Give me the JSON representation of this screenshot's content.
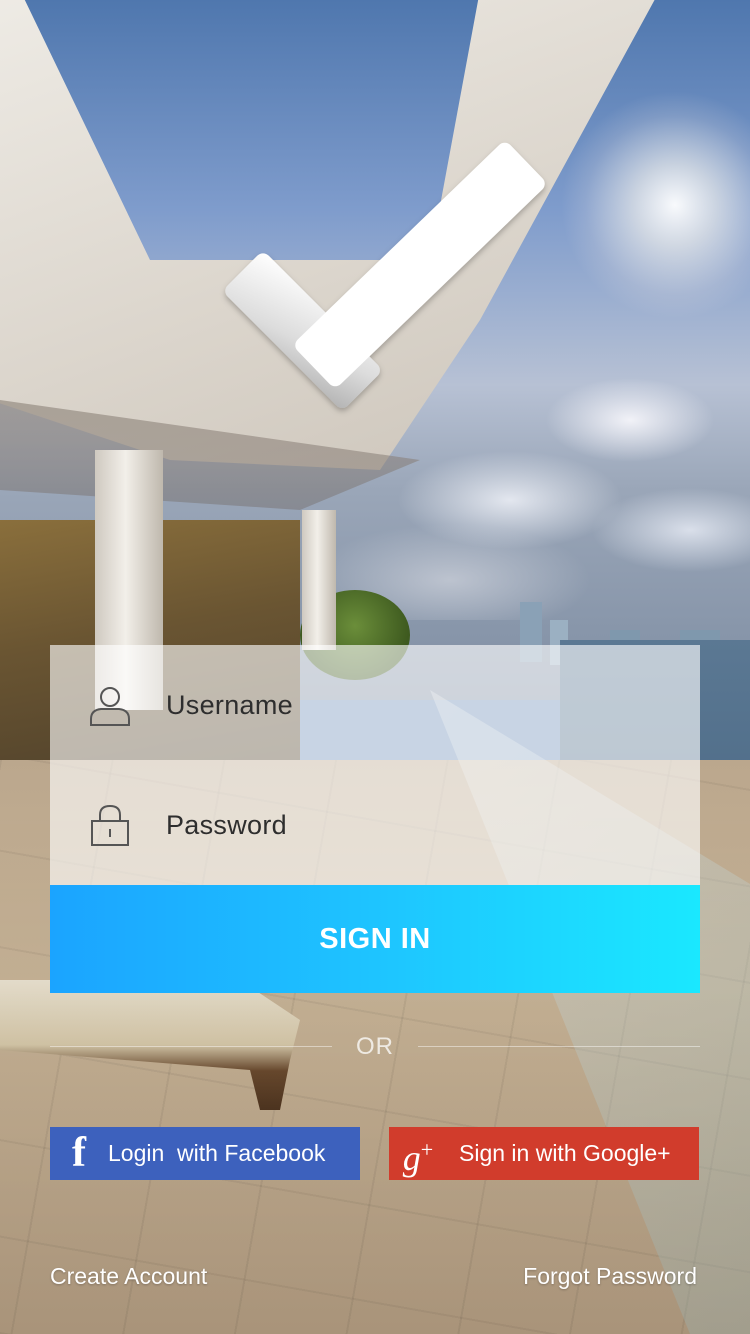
{
  "login_form": {
    "username_placeholder": "Username",
    "password_placeholder": "Password",
    "signin_label": "SIGN IN"
  },
  "divider": {
    "text": "OR"
  },
  "social": {
    "facebook_label": "Login  with Facebook",
    "google_label": "Sign in with Google+"
  },
  "links": {
    "create_account": "Create Account",
    "forgot_password": "Forgot Password"
  },
  "icons": {
    "logo": "checkmark-logo",
    "username": "user-icon",
    "password": "lock-icon",
    "facebook": "facebook-icon",
    "google": "google-plus-icon"
  },
  "colors": {
    "signin_gradient_start": "#1ba4ff",
    "signin_gradient_end": "#1ae8ff",
    "facebook": "#3d61bd",
    "google": "#d13c2c"
  }
}
